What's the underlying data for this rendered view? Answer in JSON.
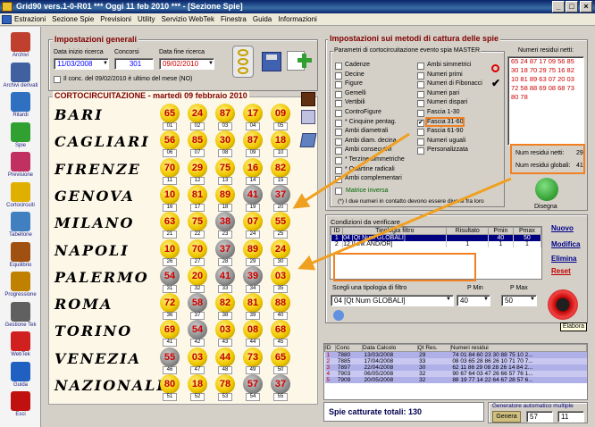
{
  "title": "Grid90 vers.1-0-R01  ***  Oggi 11 feb 2010  ***  - [Sezione Spie]",
  "menu": [
    "Estrazioni",
    "Sezione Spie",
    "Previsioni",
    "Utility",
    "Servizio WebTek",
    "Finestra",
    "Guida",
    "Informazioni"
  ],
  "sidebar": [
    "Archivi",
    "Archivi derivati",
    "Ritardi",
    "Spie",
    "Previsione",
    "Cortocircuiti",
    "Tabellone",
    "Equilibrio",
    "Progressione",
    "Gestione Tek",
    "WebTek",
    "Guida",
    "Esci"
  ],
  "general": {
    "title": "Impostazioni generali",
    "start_label": "Data inizio ricerca",
    "start": "11/03/2008",
    "contests_label": "Concorsi",
    "contests": "301",
    "end_label": "Data fine ricerca",
    "end": "09/02/2010",
    "note": "Il conc. del 09/02/2010 è ultimo del mese (NO)"
  },
  "lotto": {
    "title": "CORTOCIRCUITAZIONE - martedì 09 febbraio 2010",
    "rows": [
      {
        "city": "BARI",
        "n": [
          "65",
          "24",
          "87",
          "17",
          "09"
        ],
        "e": [
          "01",
          "02",
          "03",
          "04",
          "05"
        ],
        "grey": [
          false,
          false,
          false,
          false,
          false
        ]
      },
      {
        "city": "CAGLIARI",
        "n": [
          "56",
          "85",
          "30",
          "87",
          "18"
        ],
        "e": [
          "06",
          "07",
          "08",
          "09",
          "10"
        ],
        "grey": [
          false,
          false,
          false,
          false,
          false
        ]
      },
      {
        "city": "FIRENZE",
        "n": [
          "70",
          "29",
          "75",
          "16",
          "82"
        ],
        "e": [
          "11",
          "12",
          "13",
          "14",
          "15"
        ],
        "grey": [
          false,
          false,
          false,
          false,
          false
        ]
      },
      {
        "city": "GENOVA",
        "n": [
          "10",
          "81",
          "89",
          "41",
          "37"
        ],
        "e": [
          "16",
          "17",
          "18",
          "19",
          "20"
        ],
        "grey": [
          false,
          false,
          false,
          true,
          true
        ]
      },
      {
        "city": "MILANO",
        "n": [
          "63",
          "75",
          "38",
          "07",
          "55"
        ],
        "e": [
          "21",
          "22",
          "23",
          "24",
          "25"
        ],
        "grey": [
          false,
          false,
          true,
          false,
          false
        ]
      },
      {
        "city": "NAPOLI",
        "n": [
          "10",
          "70",
          "37",
          "89",
          "24"
        ],
        "e": [
          "26",
          "27",
          "28",
          "29",
          "30"
        ],
        "grey": [
          false,
          false,
          true,
          false,
          false
        ]
      },
      {
        "city": "PALERMO",
        "n": [
          "54",
          "20",
          "41",
          "39",
          "03"
        ],
        "e": [
          "31",
          "32",
          "33",
          "34",
          "35"
        ],
        "grey": [
          true,
          false,
          true,
          true,
          false
        ]
      },
      {
        "city": "ROMA",
        "n": [
          "72",
          "58",
          "82",
          "81",
          "88"
        ],
        "e": [
          "36",
          "37",
          "38",
          "39",
          "40"
        ],
        "grey": [
          false,
          true,
          false,
          false,
          false
        ]
      },
      {
        "city": "TORINO",
        "n": [
          "69",
          "54",
          "03",
          "08",
          "68"
        ],
        "e": [
          "41",
          "42",
          "43",
          "44",
          "45"
        ],
        "grey": [
          false,
          true,
          false,
          false,
          false
        ]
      },
      {
        "city": "VENEZIA",
        "n": [
          "55",
          "03",
          "44",
          "73",
          "65"
        ],
        "e": [
          "46",
          "47",
          "48",
          "49",
          "50"
        ],
        "grey": [
          true,
          false,
          false,
          false,
          false
        ]
      },
      {
        "city": "NAZIONALE",
        "n": [
          "80",
          "18",
          "78",
          "57",
          "37"
        ],
        "e": [
          "51",
          "52",
          "53",
          "54",
          "55"
        ],
        "grey": [
          false,
          false,
          false,
          true,
          true
        ]
      }
    ]
  },
  "methods": {
    "title": "Impostazioni sui metodi di cattura delle spie",
    "params_title": "Parametri di cortocircuitazione evento spia MASTER",
    "col1": [
      "Cadenze",
      "Decine",
      "Figure",
      "Gemelli",
      "Vertibili",
      "ControFigure",
      "* Cinquine pentag.",
      "Ambi diametrali",
      "Ambi diam. decina",
      "Ambi consecutivi",
      "* Terzine simmetriche",
      "* Quartine radicali",
      "Ambi complementari"
    ],
    "col2": [
      "Ambi simmetrici",
      "Numeri primi",
      "Numeri di Fibonacci",
      "Numeri pari",
      "Numeri dispari",
      "Fascia 1-30",
      "Fascia 31-60",
      "Fascia 61-90",
      "Numeri uguali",
      "Personalizzata"
    ],
    "matrice": "Matrice inversa",
    "note": "(*) I due numeri in contatto devono essere diversi fra loro"
  },
  "residui": {
    "title": "Numeri residui netti:",
    "text": "65 24 87 17 09 56 85 30 18 70 29 75 16 82 10 81 89 63 07 20 03 72 58 88 69 08 68 73 80 78",
    "netti_label": "Num residui netti:",
    "netti": "29",
    "globali_label": "Num residui globali:",
    "globali": "41",
    "disegna": "Disegna"
  },
  "conditions": {
    "title": "Condizioni da verificare",
    "headers": [
      "ID",
      "Tipologia filtro",
      "Risultato",
      "Pmin",
      "Pmax"
    ],
    "rows": [
      [
        "1",
        "04 [Qt Num GLOBALI]",
        "",
        "40",
        "50"
      ],
      [
        "2",
        "12 [Link AND/OR]",
        "1",
        "1",
        "1"
      ]
    ],
    "buttons": [
      "Nuovo",
      "Modifica",
      "Elimina",
      "Reset"
    ]
  },
  "filter": {
    "label": "Scegli una tipologia di filtro",
    "value": "04 [Qt Num GLOBALI]",
    "pmin_label": "P Min",
    "pmin": "40",
    "pmax_label": "P Max",
    "pmax": "50",
    "elabora": "Elabora"
  },
  "results": {
    "headers": [
      "ID",
      "Conc",
      "Data Calcolo",
      "Qt Res.",
      "Numeri residui"
    ],
    "rows": [
      [
        "1",
        "7880",
        "13/03/2008",
        "29",
        "74 01 84 60 23 30 88 75 10 2..."
      ],
      [
        "2",
        "7885",
        "17/04/2008",
        "33",
        "08 03 65 28 86 26 10 71 70 7..."
      ],
      [
        "3",
        "7897",
        "22/04/2008",
        "30",
        "62 11 86 29 08 28 26 14 84 2..."
      ],
      [
        "4",
        "7903",
        "06/05/2008",
        "32",
        "90 67 64 03 47 26 66 57 76 1..."
      ],
      [
        "5",
        "7909",
        "20/05/2008",
        "32",
        "88 19 77 14 22 64 67 28 57 6..."
      ]
    ]
  },
  "footer": {
    "spie_label": "Spie catturate totali: 130",
    "gen_title": "Generatore automatico multiple",
    "genera": "Genera",
    "v1": "57",
    "v2": "11"
  }
}
